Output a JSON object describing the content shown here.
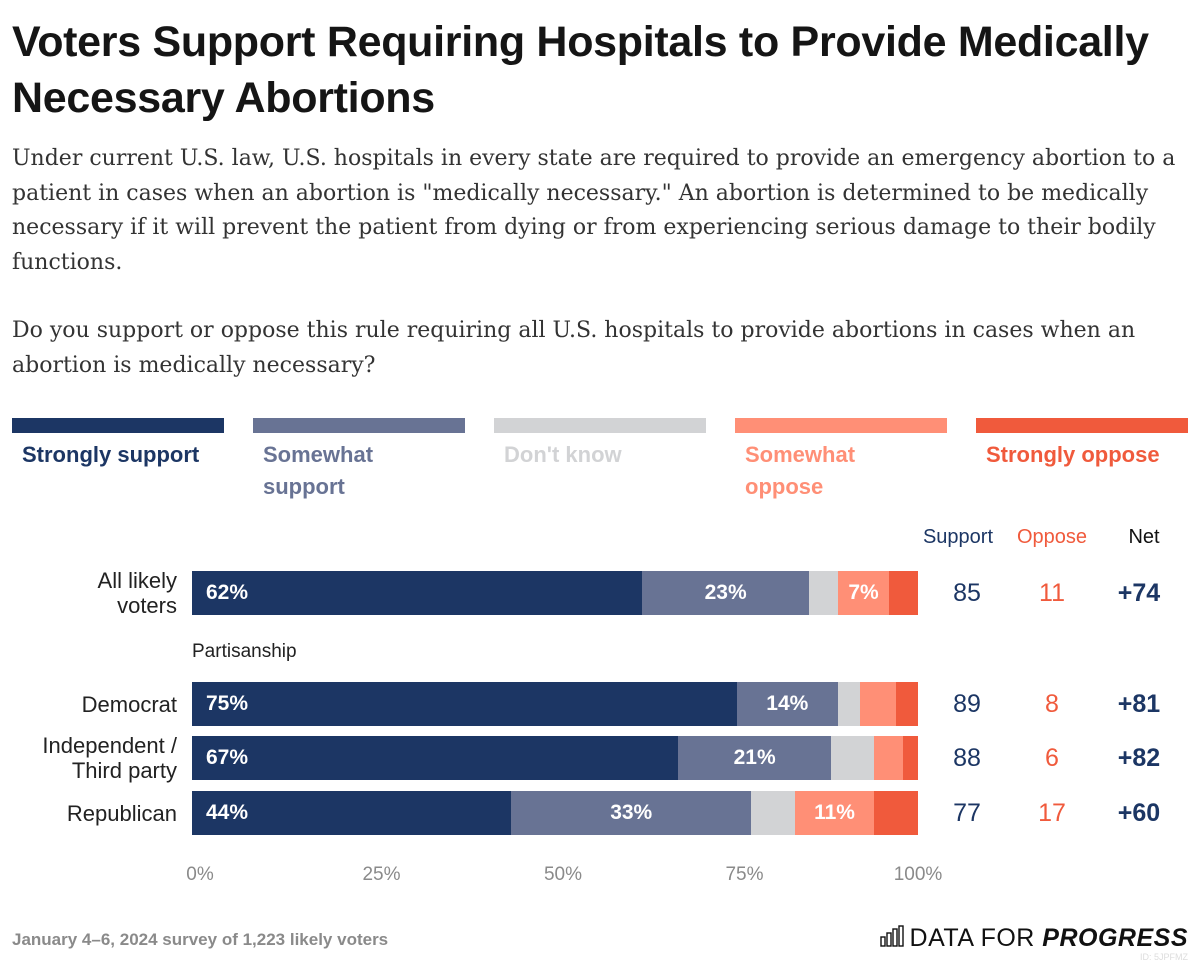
{
  "title": "Voters Support Requiring Hospitals to Provide Medically Necessary Abortions",
  "subtitle_paragraphs": [
    "Under current U.S. law, U.S. hospitals in every state are required to provide an emergency abortion to a patient in cases when an abortion is \"medically necessary.\" An abortion is determined to be medically necessary if it will prevent the patient from dying or from experiencing serious damage to their bodily functions.",
    "Do you support or oppose this rule requiring all U.S. hospitals to provide abortions in cases when an abortion is medically necessary?"
  ],
  "footer": {
    "source": "January 4–6, 2024 survey of 1,223 likely voters",
    "logo_light": "DATA FOR ",
    "logo_bold": "PROGRESS",
    "logo_id": "ID: 5JPFMZ"
  },
  "columns": {
    "support": "Support",
    "oppose": "Oppose",
    "net": "Net"
  },
  "colors": {
    "strongly_support": "#1c3664",
    "somewhat_support": "#687394",
    "dont_know": "#d2d3d5",
    "somewhat_oppose": "#ff8f76",
    "strongly_oppose": "#f05a3c",
    "support_text": "#1c3664",
    "oppose_text": "#f05a3c",
    "axis_text": "#8a8a8a"
  },
  "chart_data": {
    "type": "bar",
    "orientation": "horizontal-stacked",
    "title": "Voters Support Requiring Hospitals to Provide Medically Necessary Abortions",
    "xlabel": "",
    "ylabel": "",
    "xlim": [
      0,
      100
    ],
    "x_ticks": [
      "0%",
      "25%",
      "50%",
      "75%",
      "100%"
    ],
    "legend_position": "top",
    "legend": [
      "Strongly support",
      "Somewhat support",
      "Don't know",
      "Somewhat oppose",
      "Strongly oppose"
    ],
    "legend_labels_wrapped": [
      [
        "Strongly support"
      ],
      [
        "Somewhat",
        "support"
      ],
      [
        "Don't know"
      ],
      [
        "Somewhat",
        "oppose"
      ],
      [
        "Strongly oppose"
      ]
    ],
    "group_label": "Partisanship",
    "categories": [
      "All likely voters",
      "Democrat",
      "Independent / Third party",
      "Republican"
    ],
    "category_label_lines": [
      [
        "All likely",
        "voters"
      ],
      [
        "Democrat"
      ],
      [
        "Independent /",
        "Third party"
      ],
      [
        "Republican"
      ]
    ],
    "series": [
      {
        "name": "Strongly support",
        "values": [
          62,
          75,
          67,
          44
        ],
        "labels": [
          "62%",
          "75%",
          "67%",
          "44%"
        ]
      },
      {
        "name": "Somewhat support",
        "values": [
          23,
          14,
          21,
          33
        ],
        "labels": [
          "23%",
          "14%",
          "21%",
          "33%"
        ]
      },
      {
        "name": "Don't know",
        "values": [
          4,
          3,
          6,
          6
        ],
        "labels": [
          "",
          "",
          "",
          ""
        ]
      },
      {
        "name": "Somewhat oppose",
        "values": [
          7,
          5,
          4,
          11
        ],
        "labels": [
          "7%",
          "",
          "",
          "11%"
        ]
      },
      {
        "name": "Strongly oppose",
        "values": [
          4,
          3,
          2,
          6
        ],
        "labels": [
          "",
          "",
          "",
          ""
        ]
      }
    ],
    "support_totals": [
      85,
      89,
      88,
      77
    ],
    "oppose_totals": [
      11,
      8,
      6,
      17
    ],
    "net": [
      "+74",
      "+81",
      "+82",
      "+60"
    ]
  }
}
